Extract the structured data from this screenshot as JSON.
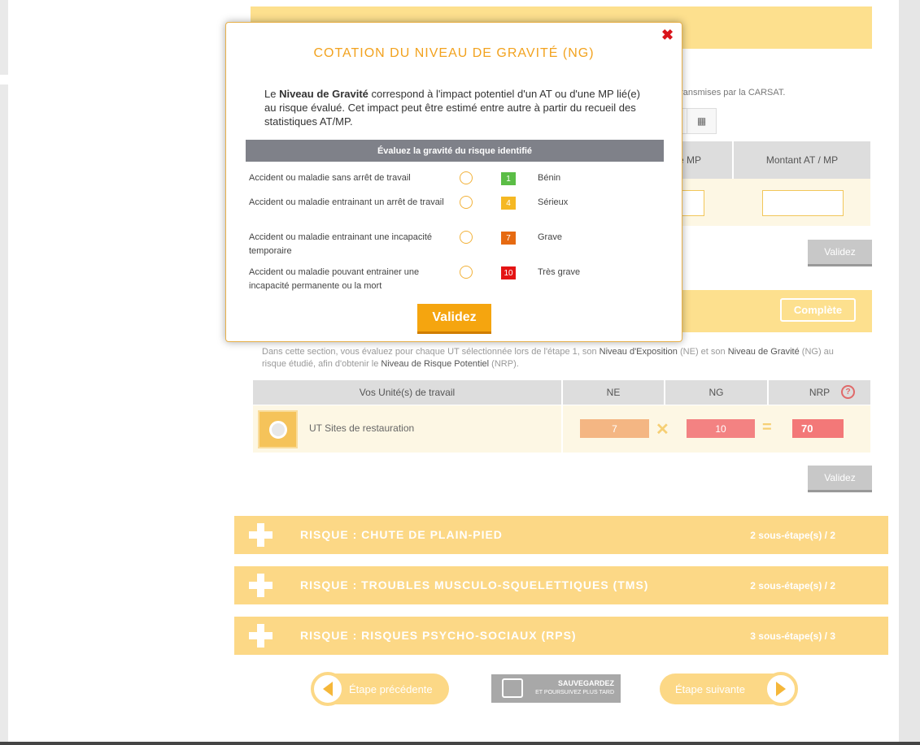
{
  "background": {
    "carsat_text": "nnées transmises par la CARSAT.",
    "date_icon": "calendar-icon",
    "table_headers": {
      "mp": "e MP",
      "montant": "Montant AT / MP"
    },
    "validez_1": "Validez",
    "section": {
      "complete_label": "Complète",
      "intro": {
        "p1": "Dans cette section, vous évaluez pour chaque UT sélectionnée lors de l'étape 1, son ",
        "b1": "Niveau d'Exposition",
        "p2": " (NE) et son ",
        "b2": "Niveau de Gravité",
        "p3": " (NG) au risque étudié, afin d'obtenir le ",
        "b3": "Niveau de Risque Potentiel",
        "p4": " (NRP)."
      },
      "columns": [
        "Vos Unité(s) de travail",
        "NE",
        "NG",
        "NRP"
      ],
      "nrp_help": "?",
      "row": {
        "name": "UT Sites de restauration",
        "ne": "7",
        "ng": "10",
        "nrp": "70"
      },
      "validez_2": "Validez"
    },
    "risks": [
      {
        "title": "RISQUE : CHUTE DE PLAIN-PIED",
        "steps": "2 sous-étape(s) / 2"
      },
      {
        "title": "RISQUE : TROUBLES MUSCULO-SQUELETTIQUES (TMS)",
        "steps": "2 sous-étape(s) / 2"
      },
      {
        "title": "RISQUE : RISQUES PSYCHO-SOCIAUX (RPS)",
        "steps": "3 sous-étape(s) / 3"
      }
    ],
    "nav": {
      "prev": "Étape précédente",
      "save_line1": "SAUVEGARDEZ",
      "save_line2": "ET POURSUIVEZ PLUS TARD",
      "next": "Étape suivante"
    }
  },
  "modal": {
    "close": "✖",
    "title": "COTATION DU NIVEAU DE GRAVITÉ (NG)",
    "desc_pre": "Le ",
    "desc_bold": "Niveau de Gravité",
    "desc_post": " correspond à l'impact potentiel d'un AT ou d'une MP lié(e) au risque évalué. Cet impact peut être estimé entre autre à partir du recueil des statistiques AT/MP.",
    "bar": "Évaluez la gravité du risque identifié",
    "options": [
      {
        "label": "Accident ou maladie sans arrêt de travail",
        "num": "1",
        "name": "Bénin",
        "color": "#5bbd46"
      },
      {
        "label": "Accident ou maladie entrainant un arrêt de travail",
        "num": "4",
        "name": "Sérieux",
        "color": "#f5b823"
      },
      {
        "label": "Accident ou maladie entrainant une incapacité temporaire",
        "num": "7",
        "name": "Grave",
        "color": "#e66a11"
      },
      {
        "label": "Accident ou maladie pouvant entrainer une incapacité permanente ou la mort",
        "num": "10",
        "name": "Très grave",
        "color": "#e41313"
      }
    ],
    "validez": "Validez"
  }
}
